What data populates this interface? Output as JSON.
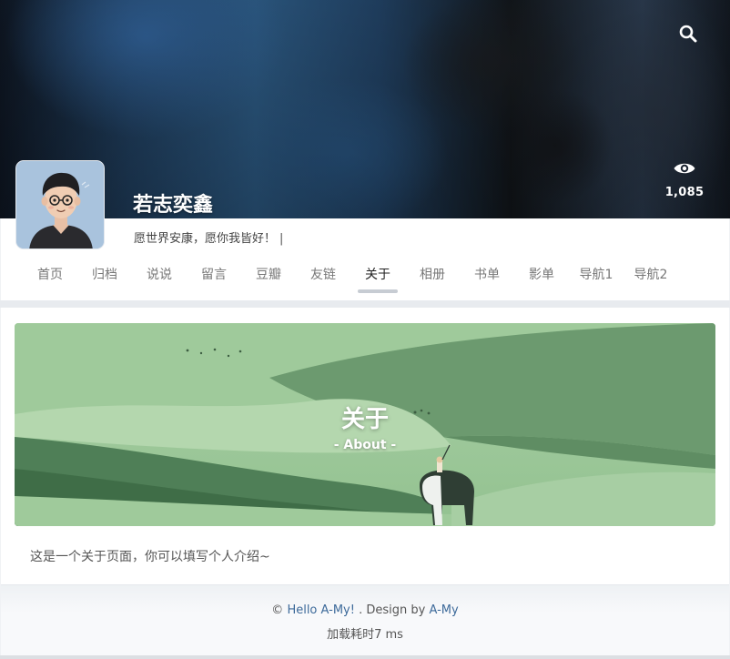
{
  "header": {
    "site_name": "若志奕鑫",
    "views_count": "1,085",
    "search_icon": "search-icon",
    "views_icon": "eye-icon"
  },
  "profile": {
    "motto": "愿世界安康，愿你我皆好！",
    "caret": "|"
  },
  "nav": {
    "items": [
      "首页",
      "归档",
      "说说",
      "留言",
      "豆瓣",
      "友链",
      "关于",
      "相册",
      "书单",
      "影单",
      "导航1",
      "导航2"
    ],
    "active": "关于"
  },
  "page": {
    "banner_title": "关于",
    "banner_subtitle": "- About -",
    "intro": "这是一个关于页面，你可以填写个人介绍~"
  },
  "footer": {
    "copyright_symbol": "©",
    "site_link": "Hello A-My!",
    "design_text": ". Design by",
    "designer_link": "A-My",
    "load_time": "加载耗时7 ms"
  },
  "colors": {
    "link": "#3d6a9a",
    "banner_green": "#8fbf8e"
  }
}
